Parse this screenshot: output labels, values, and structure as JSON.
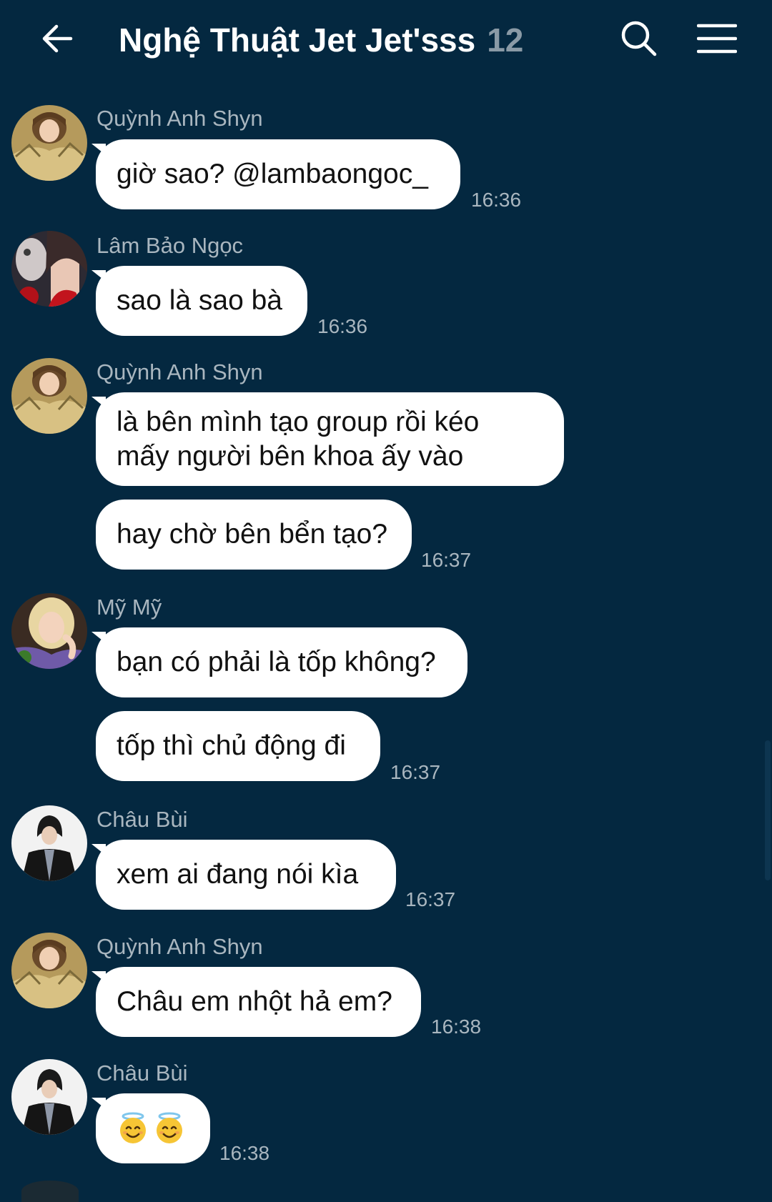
{
  "header": {
    "title": "Nghệ Thuật Jet Jet'sss",
    "member_count": "12",
    "back_icon": "arrow-left-icon",
    "search_icon": "search-icon",
    "menu_icon": "hamburger-menu-icon"
  },
  "colors": {
    "background": "#042840",
    "bubble": "#ffffff",
    "meta_text": "#a9b6bf"
  },
  "messages": [
    {
      "sender": "Quỳnh Anh Shyn",
      "text": "giờ sao? @lambaongoc_",
      "time": "16:36"
    },
    {
      "sender": "Lâm Bảo Ngọc",
      "text": "sao là sao bà",
      "time": "16:36"
    },
    {
      "sender": "Quỳnh Anh Shyn",
      "lines": [
        "là bên mình tạo group rồi kéo",
        "mấy người bên khoa ấy vào"
      ]
    },
    {
      "text": "hay chờ bên bển tạo?",
      "time": "16:37"
    },
    {
      "sender": "Mỹ Mỹ",
      "text": "bạn có phải là tốp không?"
    },
    {
      "text": "tốp thì chủ động đi",
      "time": "16:37"
    },
    {
      "sender": "Châu Bùi",
      "text": "xem ai đang nói kìa",
      "time": "16:37"
    },
    {
      "sender": "Quỳnh Anh Shyn",
      "text": "Châu em nhột hả em?",
      "time": "16:38"
    },
    {
      "sender": "Châu Bùi",
      "emoji": [
        "smiling-face-with-halo",
        "smiling-face-with-halo"
      ],
      "time": "16:38"
    }
  ]
}
